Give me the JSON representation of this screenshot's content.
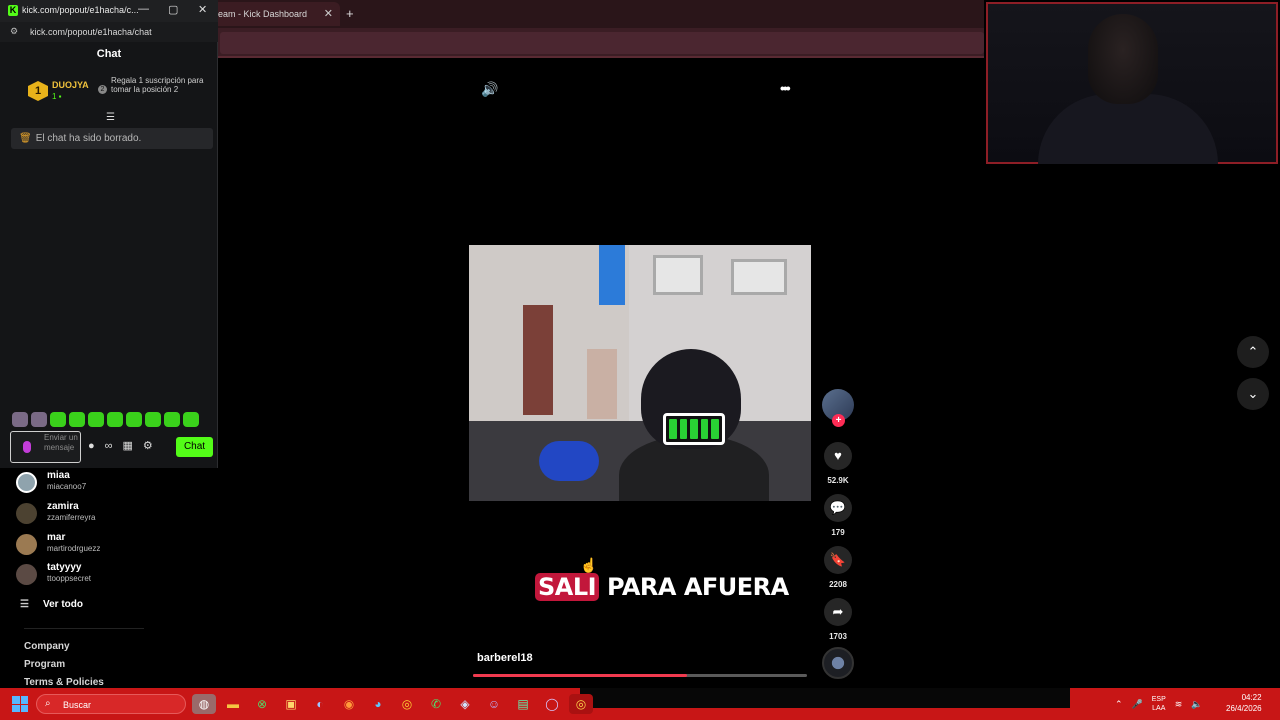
{
  "background_browser": {
    "tab_title": "eam - Kick Dashboard",
    "tab_close": "✕",
    "new_tab": "+"
  },
  "popout": {
    "title": "kick.com/popout/e1hacha/c...",
    "url": "kick.com/popout/e1hacha/chat",
    "header": "Chat",
    "leaderboard": {
      "rank": "1",
      "user": "DUOJYA",
      "count": "1",
      "hint_icon": "2",
      "hint": "Regala 1 suscripción para tomar la posición 2"
    },
    "cleared_message": "El chat ha sido borrado.",
    "input_placeholder": "Enviar un mensaje",
    "chat_button": "Chat",
    "window_controls": {
      "minimize": "—",
      "maximize": "▢",
      "close": "✕"
    }
  },
  "suggested_users": [
    {
      "name": "miaa",
      "handle": "miacanoo7"
    },
    {
      "name": "zamira",
      "handle": "zzamiferreyra"
    },
    {
      "name": "mar",
      "handle": "martirodrguezz"
    },
    {
      "name": "tatyyyy",
      "handle": "ttooppsecret"
    }
  ],
  "see_all": "Ver todo",
  "footer_links": [
    "Company",
    "Program",
    "Terms & Policies"
  ],
  "video": {
    "caption_highlight": "SALI",
    "caption_rest": " PARA AFUERA",
    "creator": "barberel18",
    "progress": 0.64
  },
  "actions": {
    "likes": "52.9K",
    "comments": "179",
    "saves": "2208",
    "shares": "1703",
    "follow": "+"
  },
  "icons": {
    "volume": "🔊",
    "more": "•••",
    "like": "♥",
    "comment": "💬",
    "save": "🔖",
    "share": "➦",
    "up": "⌃",
    "down": "⌄"
  },
  "taskbar": {
    "search": "Buscar",
    "lang_top": "ESP",
    "lang_bottom": "LAA",
    "time": "04:22",
    "date": "26/4/2026"
  },
  "colors": {
    "kick_green": "#53fc18",
    "taskbar_red": "#c81616",
    "progress_red": "#f03a4f",
    "caption_highlight": "#c2173b"
  }
}
